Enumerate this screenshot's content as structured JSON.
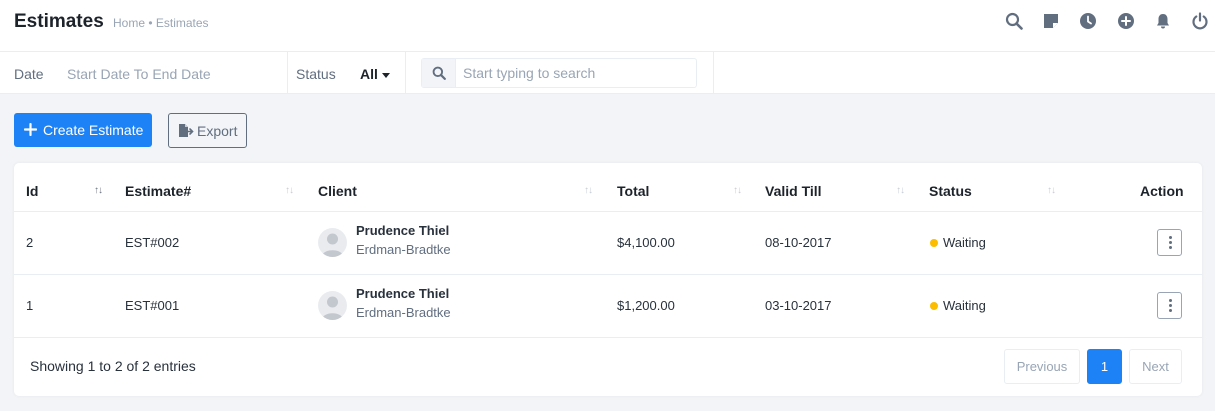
{
  "header": {
    "title": "Estimates",
    "breadcrumb": "Home • Estimates"
  },
  "top_icons": [
    "search-icon",
    "sticky-note-icon",
    "clock-icon",
    "plus-circle-icon",
    "bell-icon",
    "power-icon"
  ],
  "filters": {
    "date_label": "Date",
    "date_placeholder": "Start Date To End Date",
    "status_label": "Status",
    "status_value": "All",
    "search_placeholder": "Start typing to search",
    "search_value": ""
  },
  "actions": {
    "create_label": "Create Estimate",
    "export_label": "Export"
  },
  "table": {
    "columns": [
      "Id",
      "Estimate#",
      "Client",
      "Total",
      "Valid Till",
      "Status",
      "Action"
    ],
    "rows": [
      {
        "id": "2",
        "estimate": "EST#002",
        "client_name": "Prudence Thiel",
        "client_company": "Erdman-Bradtke",
        "total": "$4,100.00",
        "valid_till": "08-10-2017",
        "status": "Waiting"
      },
      {
        "id": "1",
        "estimate": "EST#001",
        "client_name": "Prudence Thiel",
        "client_company": "Erdman-Bradtke",
        "total": "$1,200.00",
        "valid_till": "03-10-2017",
        "status": "Waiting"
      }
    ]
  },
  "footer": {
    "entries_text": "Showing 1 to 2 of 2 entries",
    "previous_label": "Previous",
    "current_page": "1",
    "next_label": "Next"
  },
  "colors": {
    "primary": "#1d82f5",
    "waiting_status": "#fcbd01",
    "border": "#e8eef3",
    "page_bg": "#f2f4f7"
  }
}
